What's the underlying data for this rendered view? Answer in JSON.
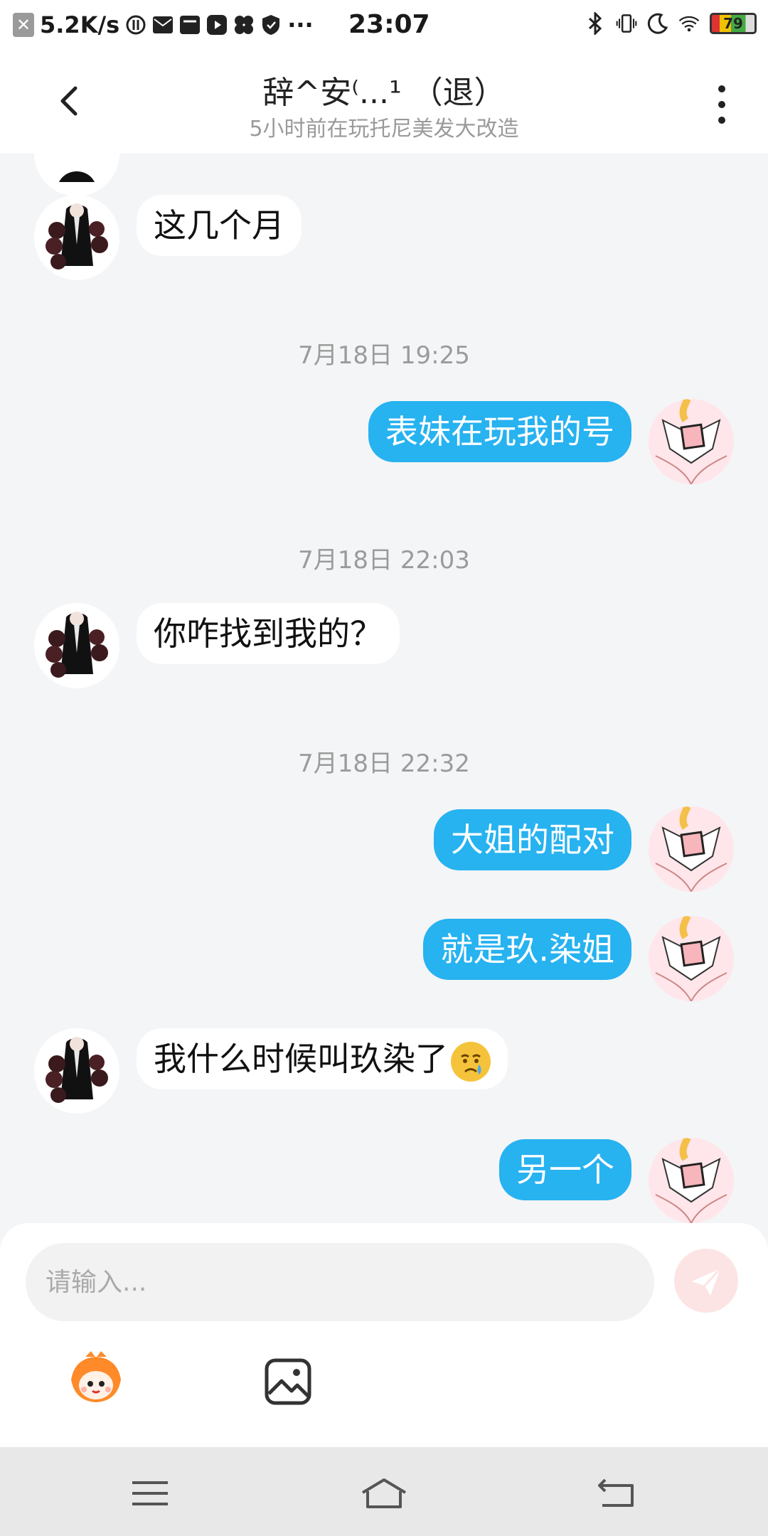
{
  "status_bar": {
    "net_speed": "5.2K/s",
    "time": "23:07",
    "battery": "79"
  },
  "header": {
    "title": "辞^安⁽...¹ （退）",
    "subtitle": "5小时前在玩托尼美发大改造"
  },
  "messages": [
    {
      "text": "这几个月"
    },
    {
      "timestamp": "7月18日 19:25"
    },
    {
      "text": "表妹在玩我的号"
    },
    {
      "timestamp": "7月18日 22:03"
    },
    {
      "text": "你咋找到我的？"
    },
    {
      "timestamp": "7月18日 22:32"
    },
    {
      "text": "大姐的配对"
    },
    {
      "text": "就是玖.染姐"
    },
    {
      "text": "我什么时候叫玖染了"
    },
    {
      "text": "另一个"
    }
  ],
  "input": {
    "placeholder": "请输入..."
  },
  "colors": {
    "accent": "#27b2f0",
    "background": "#f4f5f7",
    "send_button": "#fde4e4"
  },
  "icons": [
    "back-arrow-icon",
    "more-vertical-icon",
    "send-icon",
    "emoji-mascot-icon",
    "image-icon",
    "menu-icon",
    "home-icon",
    "back-icon"
  ]
}
